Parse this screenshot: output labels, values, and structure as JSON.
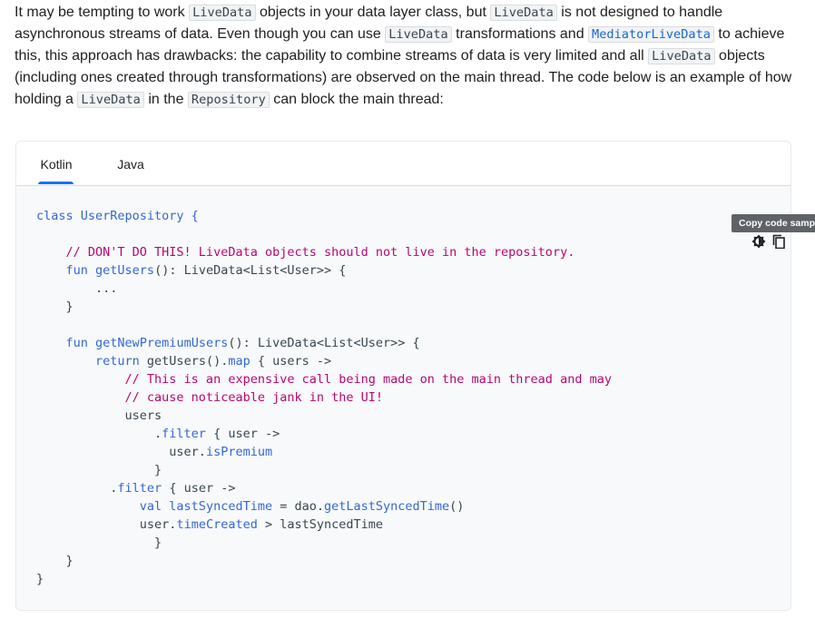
{
  "paragraph": {
    "t1": "It may be tempting to work ",
    "c1": "LiveData",
    "t2": " objects in your data layer class, but ",
    "c2": "LiveData",
    "t3": " is not designed to handle asynchronous streams of data. Even though you can use ",
    "c3": "LiveData",
    "t4": " transformations and ",
    "c4": "MediatorLiveData",
    "t5": " to achieve this, this approach has drawbacks: the capability to combine streams of data is very limited and all ",
    "c5": "LiveData",
    "t6": " objects (including ones created through transformations) are observed on the main thread. The code below is an example of how holding a ",
    "c6": "LiveData",
    "t7": " in the ",
    "c7": "Repository",
    "t8": " can block the main thread:"
  },
  "tabs": {
    "kotlin": "Kotlin",
    "java": "Java",
    "active": "Kotlin"
  },
  "toolbar": {
    "dark_mode_icon": "dark-mode-icon",
    "copy_icon": "copy-icon",
    "tooltip": "Copy code sample"
  },
  "code": {
    "l1a": "class",
    "l1b": " UserRepository {",
    "l3": "    // DON'T DO THIS! LiveData objects should not live in the repository.",
    "l4a": "    fun",
    "l4b": " getUsers",
    "l4c": "(): LiveData<List<User>> {",
    "l5": "        ...",
    "l6": "    }",
    "l8a": "    fun",
    "l8b": " getNewPremiumUsers",
    "l8c": "(): LiveData<List<User>> {",
    "l9a": "        return",
    "l9b": " getUsers().",
    "l9c": "map",
    "l9d": " { users ->",
    "l10": "            // This is an expensive call being made on the main thread and may",
    "l11": "            // cause noticeable jank in the UI!",
    "l12": "            users",
    "l13a": "                .",
    "l13b": "filter",
    "l13c": " { user ->",
    "l14a": "                  user.",
    "l14b": "isPremium",
    "l15": "                }",
    "l16a": "          .",
    "l16b": "filter",
    "l16c": " { user ->",
    "l17a": "              val",
    "l17b": " lastSyncedTime",
    "l17c": " = dao.",
    "l17d": "getLastSyncedTime",
    "l17e": "()",
    "l18a": "              user.",
    "l18b": "timeCreated",
    "l18c": " > lastSyncedTime",
    "l19": "                }",
    "l20": "    }",
    "l21": "}"
  },
  "colors": {
    "keyword": "#3367d6",
    "comment": "#b80672",
    "plain": "#37474f",
    "tab_accent": "#1a73e8"
  }
}
